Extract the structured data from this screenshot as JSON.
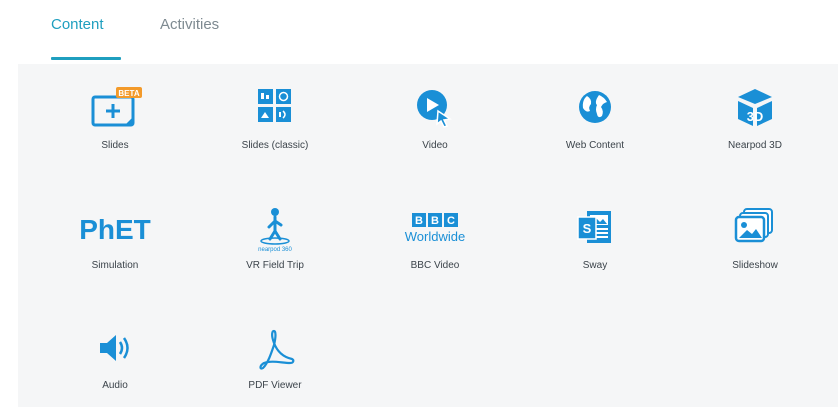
{
  "tabs": {
    "content": "Content",
    "activities": "Activities"
  },
  "tiles": [
    {
      "label": "Slides",
      "icon": "slides-icon",
      "badge": "BETA"
    },
    {
      "label": "Slides (classic)",
      "icon": "slides-classic-icon"
    },
    {
      "label": "Video",
      "icon": "video-icon"
    },
    {
      "label": "Web Content",
      "icon": "globe-icon"
    },
    {
      "label": "Nearpod 3D",
      "icon": "nearpod-3d-icon",
      "glyph": "3D"
    },
    {
      "label": "Simulation",
      "icon": "phet-logo",
      "logo": "PhET"
    },
    {
      "label": "VR Field Trip",
      "icon": "vr-field-trip-icon",
      "logo": "nearpod 360"
    },
    {
      "label": "BBC Video",
      "icon": "bbc-worldwide-logo",
      "logo": [
        "B",
        "B",
        "C"
      ],
      "logo_sub": "Worldwide"
    },
    {
      "label": "Sway",
      "icon": "sway-icon",
      "glyph": "S"
    },
    {
      "label": "Slideshow",
      "icon": "slideshow-icon"
    },
    {
      "label": "Audio",
      "icon": "audio-icon"
    },
    {
      "label": "PDF Viewer",
      "icon": "pdf-icon"
    }
  ],
  "colors": {
    "accent": "#1f9fbf",
    "icon": "#1a8fd6",
    "badge": "#f39a2a",
    "muted": "#7e8a91"
  }
}
